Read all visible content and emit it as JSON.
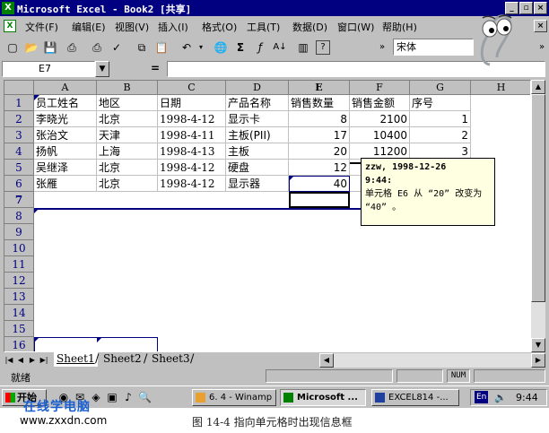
{
  "window": {
    "title": "Microsoft Excel - Book2  [共享]",
    "app_icon": "excel-icon"
  },
  "menu": [
    "文件(F)",
    "编辑(E)",
    "视图(V)",
    "插入(I)",
    "格式(O)",
    "工具(T)",
    "数据(D)",
    "窗口(W)",
    "帮助(H)"
  ],
  "toolbar": {
    "font_name": "宋体",
    "icons": [
      "new-icon",
      "open-icon",
      "save-icon",
      "print-icon",
      "print-preview-icon",
      "spelling-icon",
      "copy-icon",
      "paste-icon",
      "undo-icon",
      "hyperlink-icon",
      "autosum-icon",
      "function-icon",
      "sort-ascending-icon",
      "chart-icon",
      "help-icon"
    ]
  },
  "formula_bar": {
    "name_box": "E7",
    "equals": "="
  },
  "columns": [
    "A",
    "B",
    "C",
    "D",
    "E",
    "F",
    "G",
    "H"
  ],
  "active_column": "E",
  "rows": [
    "1",
    "2",
    "3",
    "4",
    "5",
    "6",
    "7",
    "8",
    "9",
    "10",
    "11",
    "12",
    "13",
    "14",
    "15",
    "16"
  ],
  "active_row": "7",
  "table": {
    "header": [
      "员工姓名",
      "地区",
      "日期",
      "产品名称",
      "销售数量",
      "销售金额",
      "序号"
    ],
    "data": [
      [
        "李晓光",
        "北京",
        "1998-4-12",
        "显示卡",
        "8",
        "2100",
        "1"
      ],
      [
        "张治文",
        "天津",
        "1998-4-11",
        "主板(PII)",
        "17",
        "10400",
        "2"
      ],
      [
        "扬帆",
        "上海",
        "1998-4-13",
        "主板",
        "20",
        "11200",
        "3"
      ],
      [
        "吴继泽",
        "北京",
        "1998-4-12",
        "硬盘",
        "12",
        "",
        ""
      ],
      [
        "张雁",
        "北京",
        "1998-4-12",
        "显示器",
        "40",
        "",
        ""
      ]
    ]
  },
  "comment": {
    "header": "zzw, 1998-12-26",
    "header2": "9:44:",
    "body": "单元格 E6 从 “20” 改变为",
    "body2": "“40” 。"
  },
  "sheet_tabs": [
    "Sheet1",
    "Sheet2",
    "Sheet3"
  ],
  "active_sheet": "Sheet1",
  "status": {
    "text": "就绪",
    "numlock": "NUM"
  },
  "taskbar": {
    "start": "开始",
    "tasks": [
      "6. 4 - Winamp",
      "Microsoft ...",
      "EXCEL814 -..."
    ],
    "ime": "En",
    "clock": "9:44"
  },
  "watermark": {
    "line1": "在线学电脑",
    "line2": "www.zxxdn.com"
  },
  "caption": "图 14-4  指向单元格时出现信息框"
}
